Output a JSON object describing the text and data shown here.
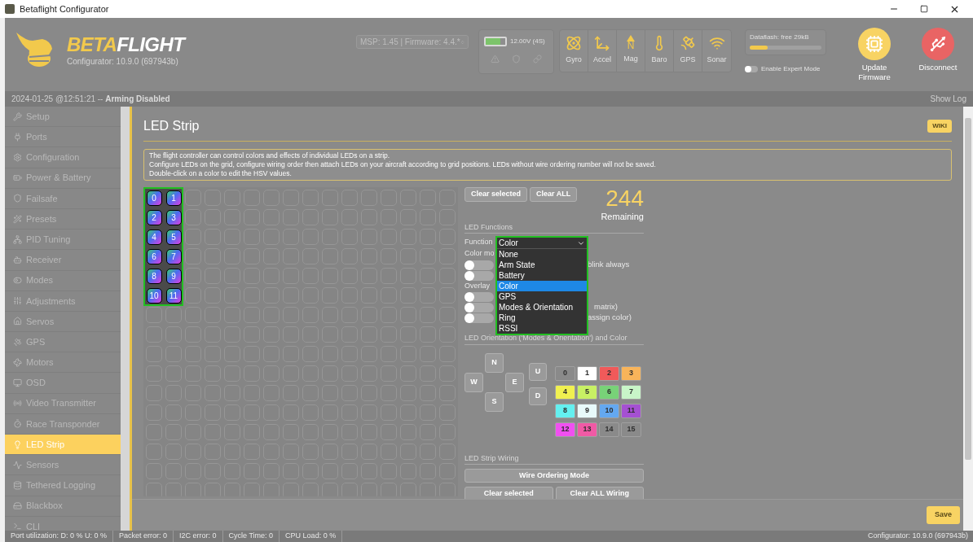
{
  "window": {
    "title": "Betaflight Configurator"
  },
  "header": {
    "logo_word_a": "BETA",
    "logo_word_b": "FLIGHT",
    "version": "Configurator: 10.9.0 (697943b)",
    "msp_select": "MSP: 1.45 | Firmware: 4.4.*",
    "battery": {
      "reading": "12.00V (4S)",
      "level": 0.75
    },
    "sensors": [
      {
        "label": "Gyro"
      },
      {
        "label": "Accel"
      },
      {
        "label": "Mag",
        "glyph": "N"
      },
      {
        "label": "Baro"
      },
      {
        "label": "GPS"
      },
      {
        "label": "Sonar"
      }
    ],
    "dataflash": {
      "label": "Dataflash: free 29kB",
      "level": 0.25
    },
    "expert_mode": {
      "label": "Enable Expert Mode",
      "on": false
    },
    "actions": [
      {
        "label": "Update\nFirmware",
        "kind": "update"
      },
      {
        "label": "Disconnect",
        "kind": "disconnect"
      }
    ]
  },
  "log_bar": {
    "timestamp": "2024-01-25 @12:51:21 --",
    "status": "Arming Disabled",
    "show_log": "Show Log"
  },
  "sidebar": {
    "items": [
      {
        "label": "Setup",
        "selected": false
      },
      {
        "label": "Ports",
        "selected": false
      },
      {
        "label": "Configuration",
        "selected": false
      },
      {
        "label": "Power & Battery",
        "selected": false
      },
      {
        "label": "Failsafe",
        "selected": false
      },
      {
        "label": "Presets",
        "selected": false
      },
      {
        "label": "PID Tuning",
        "selected": false
      },
      {
        "label": "Receiver",
        "selected": false
      },
      {
        "label": "Modes",
        "selected": false
      },
      {
        "label": "Adjustments",
        "selected": false
      },
      {
        "label": "Servos",
        "selected": false
      },
      {
        "label": "GPS",
        "selected": false
      },
      {
        "label": "Motors",
        "selected": false
      },
      {
        "label": "OSD",
        "selected": false
      },
      {
        "label": "Video Transmitter",
        "selected": false
      },
      {
        "label": "Race Transponder",
        "selected": false
      },
      {
        "label": "LED Strip",
        "selected": true
      },
      {
        "label": "Sensors",
        "selected": false
      },
      {
        "label": "Tethered Logging",
        "selected": false
      },
      {
        "label": "Blackbox",
        "selected": false
      },
      {
        "label": "CLI",
        "selected": false
      }
    ]
  },
  "page": {
    "title": "LED Strip",
    "wiki": "WIKI",
    "note": [
      "The flight controller can control colors and effects of individual LEDs on a strip.",
      "Configure LEDs on the grid, configure wiring order then attach LEDs on your aircraft according to grid positions. LEDs without wire ordering number will not be saved.",
      "Double-click on a color to edit the HSV values."
    ],
    "leds": [
      "0",
      "1",
      "2",
      "3",
      "4",
      "5",
      "6",
      "7",
      "8",
      "9",
      "10",
      "11"
    ],
    "grid_buttons": [
      "Clear selected",
      "Clear ALL"
    ],
    "remaining_count": "244",
    "remaining_label": "Remaining",
    "functions": {
      "heading": "LED Functions",
      "function_label": "Function",
      "select_value": "Color",
      "options": [
        {
          "label": "None",
          "selected": false
        },
        {
          "label": "Arm State",
          "selected": false
        },
        {
          "label": "Battery",
          "selected": false
        },
        {
          "label": "Color",
          "selected": true
        },
        {
          "label": "GPS",
          "selected": false
        },
        {
          "label": "Modes & Orientation",
          "selected": false
        },
        {
          "label": "Ring",
          "selected": false
        },
        {
          "label": "RSSI",
          "selected": false
        }
      ],
      "color_mode_label": "Color mo",
      "overlay_label": "Overlay",
      "color_toggles": [
        {
          "on": false,
          "label": "blink always"
        },
        {
          "on": false
        }
      ],
      "overlay_toggles": [
        {
          "on": false
        },
        {
          "on": false,
          "label": "matrix)"
        },
        {
          "on": false,
          "label": "assign color)"
        }
      ]
    },
    "orientation": {
      "heading": "LED Orientation ('Modes & Orientation') and Color",
      "directions": [
        "N",
        "W",
        "E",
        "S"
      ],
      "vertical": [
        "U",
        "D"
      ],
      "colors": [
        {
          "label": "0",
          "color": "#8a8a8a"
        },
        {
          "label": "1",
          "color": "#ffffff"
        },
        {
          "label": "2",
          "color": "#f05a5a"
        },
        {
          "label": "3",
          "color": "#f8b45a"
        },
        {
          "label": "4",
          "color": "#f0f050"
        },
        {
          "label": "5",
          "color": "#c8f064"
        },
        {
          "label": "6",
          "color": "#78d278"
        },
        {
          "label": "7",
          "color": "#c8f5c8"
        },
        {
          "label": "8",
          "color": "#64f0f0"
        },
        {
          "label": "9",
          "color": "#e8fafa"
        },
        {
          "label": "10",
          "color": "#64a8f0"
        },
        {
          "label": "11",
          "color": "#a550d2"
        },
        {
          "label": "12",
          "color": "#f050f0"
        },
        {
          "label": "13",
          "color": "#f05aa5"
        },
        {
          "label": "14",
          "color": "#8a8a8a"
        },
        {
          "label": "15",
          "color": "#8a8a8a"
        }
      ]
    },
    "wiring": {
      "heading": "LED Strip Wiring",
      "mode_button": "Wire Ordering Mode",
      "buttons": [
        "Clear selected",
        "Clear ALL Wiring"
      ]
    },
    "save": "Save"
  },
  "status_bar": {
    "items": [
      "Port utilization: D: 0 % U: 0 %",
      "Packet error: 0",
      "I2C error: 0",
      "Cycle Time: 0",
      "CPU Load: 0 %"
    ],
    "version": "Configurator: 10.9.0 (697943b)"
  }
}
